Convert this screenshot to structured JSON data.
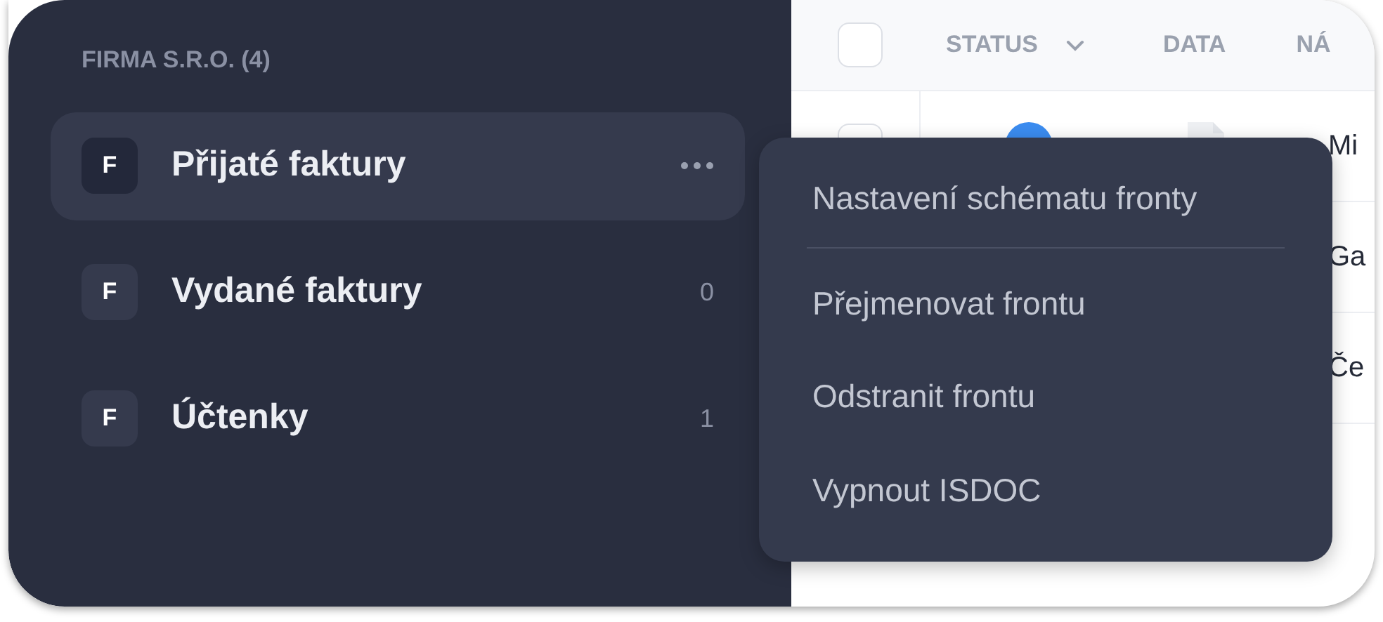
{
  "sidebar": {
    "heading": "FIRMA S.R.O. (4)",
    "items": [
      {
        "badge": "F",
        "label": "Přijaté faktury",
        "selected": true
      },
      {
        "badge": "F",
        "label": "Vydané faktury",
        "count": "0",
        "selected": false
      },
      {
        "badge": "F",
        "label": "Účtenky",
        "count": "1",
        "selected": false
      }
    ]
  },
  "table": {
    "header_checked": false,
    "columns": [
      {
        "label": "STATUS",
        "sortable": true
      },
      {
        "label": "DATA",
        "sortable": false
      },
      {
        "label": "NÁ",
        "sortable": false
      }
    ],
    "rows": [
      {
        "name": "Mi",
        "icons_visible": true,
        "checked": false
      },
      {
        "name": "Ga"
      },
      {
        "name": "Če"
      }
    ]
  },
  "context_menu": {
    "items": [
      {
        "label": "Nastavení schématu fronty",
        "separator_after": true
      },
      {
        "label": "Přejmenovat frontu",
        "separator_after": false
      },
      {
        "label": "Odstranit frontu",
        "separator_after": false
      },
      {
        "label": "Vypnout ISDOC",
        "separator_after": false
      }
    ]
  }
}
